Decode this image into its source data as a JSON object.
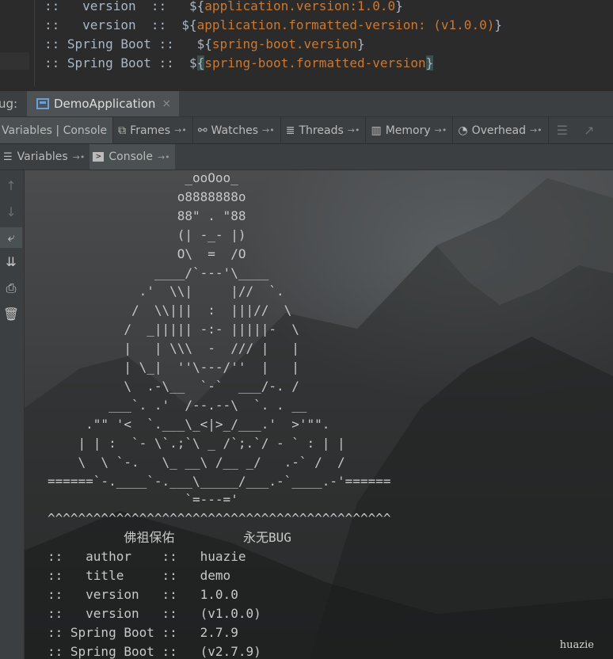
{
  "editor": {
    "lines": [
      {
        "prefix": "::   version  ::   ",
        "open": "${",
        "expr": "application.version:1.0.0",
        "close": "}"
      },
      {
        "prefix": "::   version  ::  ",
        "open": "${",
        "expr": "application.formatted-version: (v1.0.0)",
        "close": "}"
      },
      {
        "prefix": ":: Spring Boot ::   ",
        "open": "${",
        "expr": "spring-boot.version",
        "close": "}"
      },
      {
        "prefix": ":: Spring Boot ::  ",
        "open": "${",
        "expr": "spring-boot.formatted-version",
        "close": "}"
      }
    ]
  },
  "debug": {
    "label": "ug:",
    "tab_name": "DemoApplication",
    "tab_close": "×"
  },
  "toolbar": {
    "variables_console": "Variables | Console",
    "frames": "Frames",
    "watches": "Watches",
    "threads": "Threads",
    "memory": "Memory",
    "overhead": "Overhead",
    "pin": "→•"
  },
  "subtabs": {
    "variables": "Variables",
    "console": "Console",
    "pin": "→•"
  },
  "console": {
    "lines": [
      "                  _ooOoo_",
      "                 o8888888o",
      "                 88\" . \"88",
      "                 (| -_- |)",
      "                 O\\  =  /O",
      "              ____/`---'\\____",
      "            .'  \\\\|     |//  `.",
      "           /  \\\\|||  :  |||//  \\",
      "          /  _||||| -:- |||||-  \\",
      "          |   | \\\\\\  -  /// |   |",
      "          | \\_|  ''\\---/''  |   |",
      "          \\  .-\\__  `-`  ___/-. /",
      "        ___`. .'  /--.--\\  `. . __",
      "     .\"\" '<  `.___\\_<|>_/___.'  >'\"\".",
      "    | | :  `- \\`.;`\\ _ /`;.`/ - ` : | |",
      "    \\  \\ `-.   \\_ __\\ /__ _/   .-` /  /",
      "======`-.____`-.___\\_____/___.-`____.-'======",
      "                  `=---='",
      "^^^^^^^^^^^^^^^^^^^^^^^^^^^^^^^^^^^^^^^^^^^^^",
      "          佛祖保佑         永无BUG",
      "::   author    ::   huazie",
      "::   title     ::   demo",
      "::   version   ::   1.0.0",
      "::   version   ::   (v1.0.0)",
      ":: Spring Boot ::   2.7.9",
      ":: Spring Boot ::   (v2.7.9)"
    ],
    "watermark": "huazie"
  },
  "colors": {
    "editor_bg": "#2b2b2b",
    "panel_bg": "#3c3f41",
    "string_orange": "#cc7832",
    "text": "#a9b7c6"
  }
}
